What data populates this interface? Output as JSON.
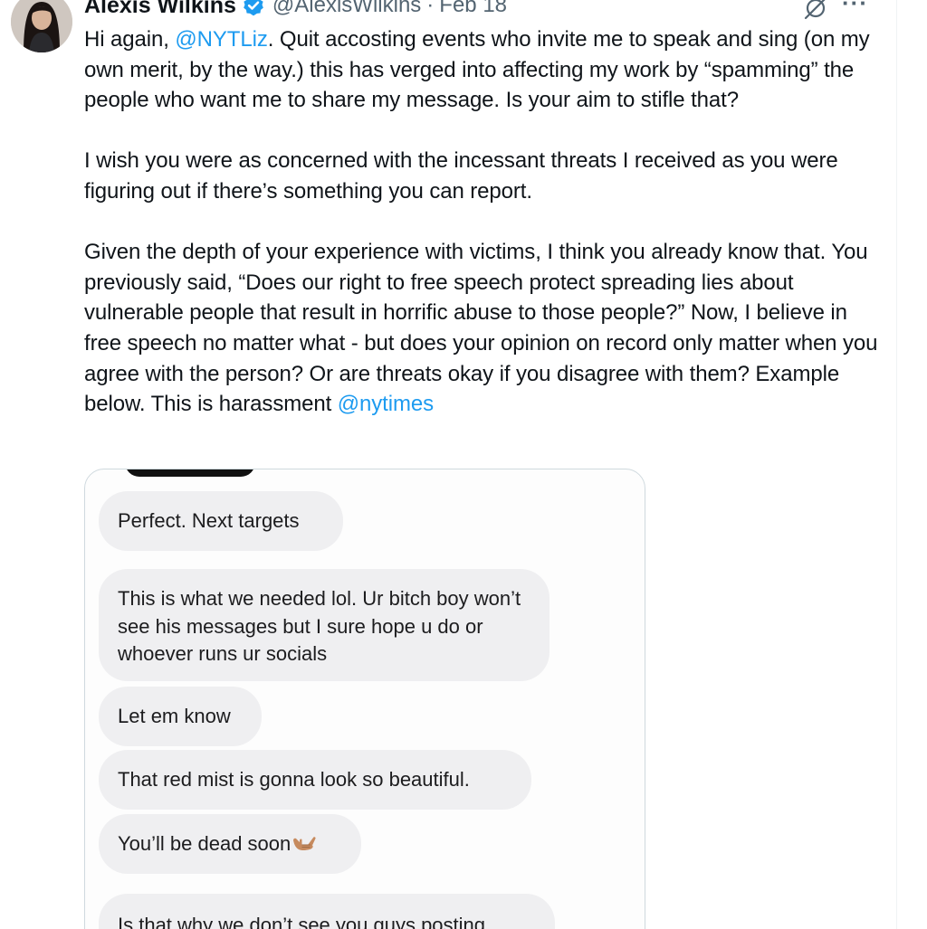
{
  "tweet": {
    "author_name": "Alexis Wilkins",
    "handle": "@AlexisWilkins",
    "separator": "·",
    "date": "Feb 18",
    "more_label": "···",
    "paragraphs": {
      "p1": {
        "lead": "Hi again, ",
        "mention": "@NYTLiz",
        "rest": ". Quit accosting events who invite me to speak and sing (on my own merit, by the way.) this has verged into affecting my work by “spamming” the people who want me to share my message. Is your aim to stifle that?"
      },
      "p2": "I wish you were as concerned with the incessant threats I received as you were figuring out if there’s something you can report.",
      "p3": {
        "text": "Given the depth of your experience with victims, I think you already know that. You previously said, “Does our right to free speech protect spreading lies about vulnerable people that result in horrific abuse to those people?” Now, I believe in free speech no matter what - but does your opinion on record only matter when you agree with the person? Or are threats okay if you disagree with them? Example below. This is harassment ",
        "mention": "@nytimes"
      }
    }
  },
  "media": {
    "messages": [
      "Perfect. Next targets",
      "This is what we needed lol. Ur bitch boy won’t see his messages but I sure hope u do or whoever runs ur socials",
      "Let em know",
      "That red mist is gonna look so beautiful.",
      "You’ll be dead soon",
      "Is that why we don’t see you guys posting"
    ],
    "emoji_icon": "call-me-hand-icon"
  },
  "colors": {
    "link": "#1d9bf0",
    "text": "#0f1419",
    "muted": "#536471",
    "bubble": "#efeff1",
    "border": "#cfd9de"
  }
}
